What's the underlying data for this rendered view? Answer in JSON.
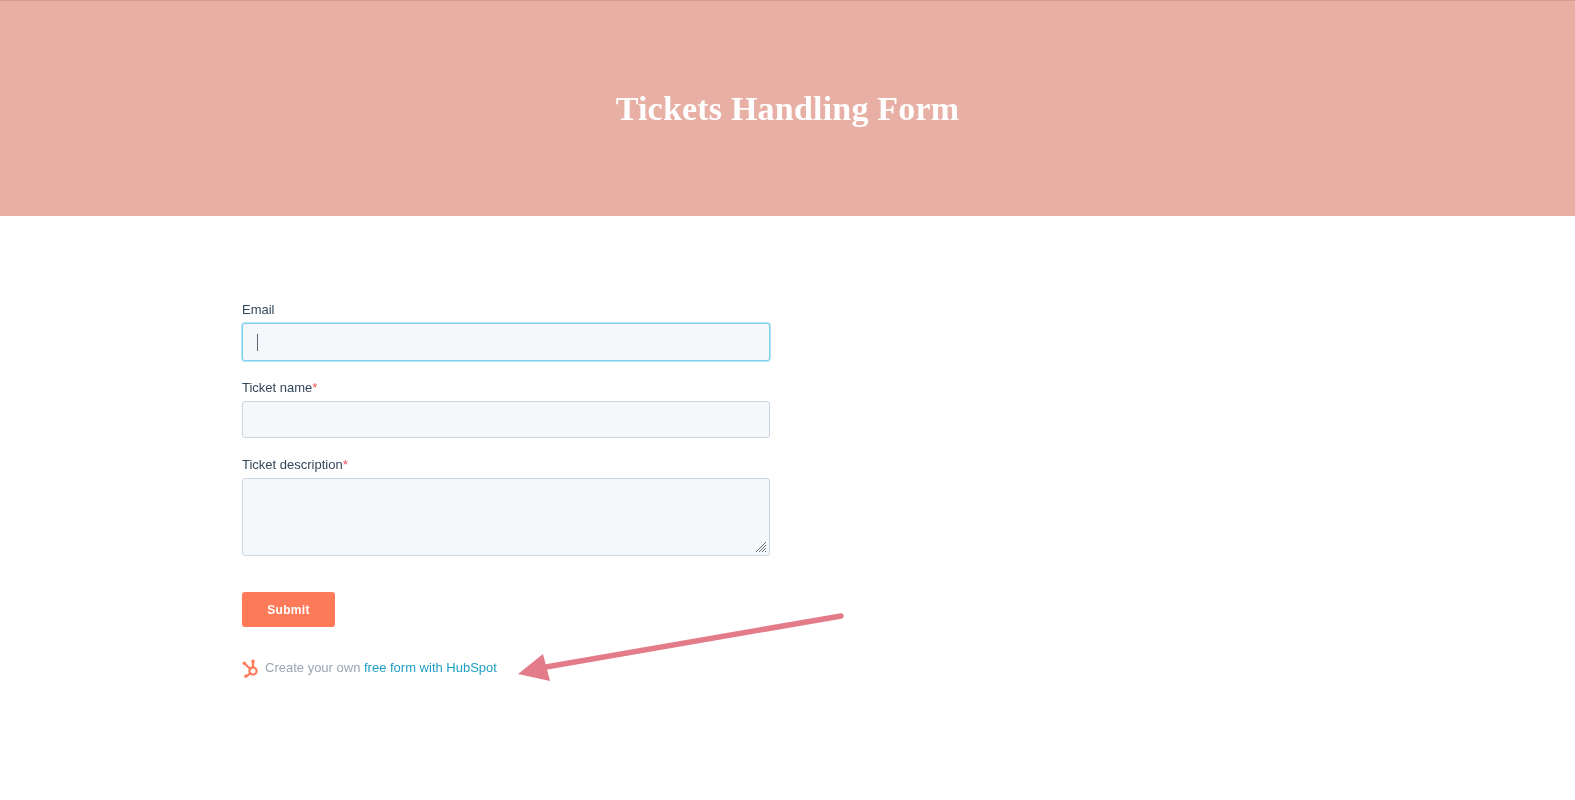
{
  "header": {
    "title": "Tickets Handling Form"
  },
  "fields": [
    {
      "label": "Email",
      "kind": "input",
      "focused": true
    },
    {
      "label": "Ticket name",
      "required_mark": "*",
      "kind": "input",
      "focused": false
    },
    {
      "label": "Ticket description",
      "required_mark": "*",
      "kind": "textarea",
      "focused": false
    }
  ],
  "submit": {
    "label": "Submit"
  },
  "footer": {
    "text": "Create your own",
    "link": "free form with HubSpot"
  }
}
